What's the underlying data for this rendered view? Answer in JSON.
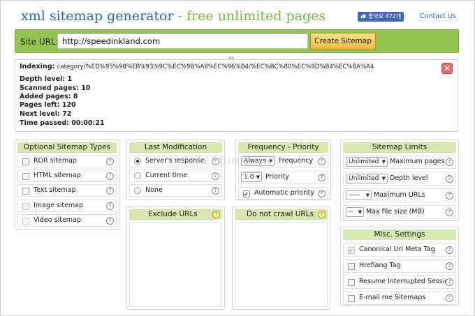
{
  "header": {
    "title_main": "xml sitemap generator",
    "title_sep": " - ",
    "title_sub": "free unlimited pages",
    "like_label": "좋아요 472개",
    "contact_label": "Contact Us"
  },
  "urlbar": {
    "label": "Site URL:",
    "url_value": "http://speedinkland.com",
    "create_button": "Create Sitemap"
  },
  "status": {
    "indexing_label": "Indexing:",
    "indexing_value": "category/%ED%95%98%EB%93%9C%EC%9B%A8%EC%96%B4/%EC%BC%80%EC%9D%B4%EC%8A%A4",
    "depth_label": "Depth level:",
    "depth_value": "1",
    "scanned_label": "Scanned pages:",
    "scanned_value": "10",
    "added_label": "Added pages:",
    "added_value": "8",
    "left_label": "Pages left:",
    "left_value": "120",
    "next_label": "Next level:",
    "next_value": "72",
    "time_label": "Time passed:",
    "time_value": "00:00:21"
  },
  "optional_types": {
    "title": "Optional Sitemap Types",
    "items": [
      {
        "label": "ROR sitemap",
        "checked": false,
        "disabled": false
      },
      {
        "label": "HTML sitemap",
        "checked": false,
        "disabled": false
      },
      {
        "label": "Text sitemap",
        "checked": false,
        "disabled": false
      },
      {
        "label": "Image sitemap",
        "checked": false,
        "disabled": true
      },
      {
        "label": "Video sitemap",
        "checked": false,
        "disabled": true
      }
    ]
  },
  "last_modification": {
    "title": "Last Modification",
    "options": [
      {
        "label": "Server's response",
        "selected": true
      },
      {
        "label": "Current time",
        "selected": false
      },
      {
        "label": "None",
        "selected": false
      }
    ]
  },
  "frequency": {
    "title": "Frequency - Priority",
    "freq_select": "Always",
    "freq_label": "Frequency",
    "prio_select": "1.0",
    "prio_label": "Priority",
    "auto_label": "Automatic priority",
    "auto_checked": true
  },
  "limits": {
    "title": "Sitemap Limits",
    "max_pages_select": "Unlimited",
    "max_pages_label": "Maximum pages",
    "depth_select": "Unlimited",
    "depth_label": "Depth level",
    "max_urls_select": "-----",
    "max_urls_label": "Maximum URLs",
    "max_size_select": "--",
    "max_size_label": "Max file size (MB)"
  },
  "exclude": {
    "title": "Exclude URLs"
  },
  "nocrawl": {
    "title": "Do not crawl URLs"
  },
  "misc": {
    "title": "Misc. Settings",
    "items": [
      {
        "label": "Canonical Url Meta Tag",
        "checked": true,
        "disabled": true
      },
      {
        "label": "Hreflang Tag",
        "checked": false,
        "disabled": false
      },
      {
        "label": "Resume Interrupted Session",
        "checked": false,
        "disabled": false
      },
      {
        "label": "E-mail me Sitemaps",
        "checked": false,
        "disabled": false
      }
    ]
  },
  "watermark_text": "SPEEDINKLAND",
  "help_glyph": "?",
  "colors": {
    "accent_green": "#93c452",
    "panel_header": "#d5e8ae",
    "title_blue": "#2b67b5",
    "title_green": "#7ab548",
    "button_orange": "#f0b840"
  }
}
